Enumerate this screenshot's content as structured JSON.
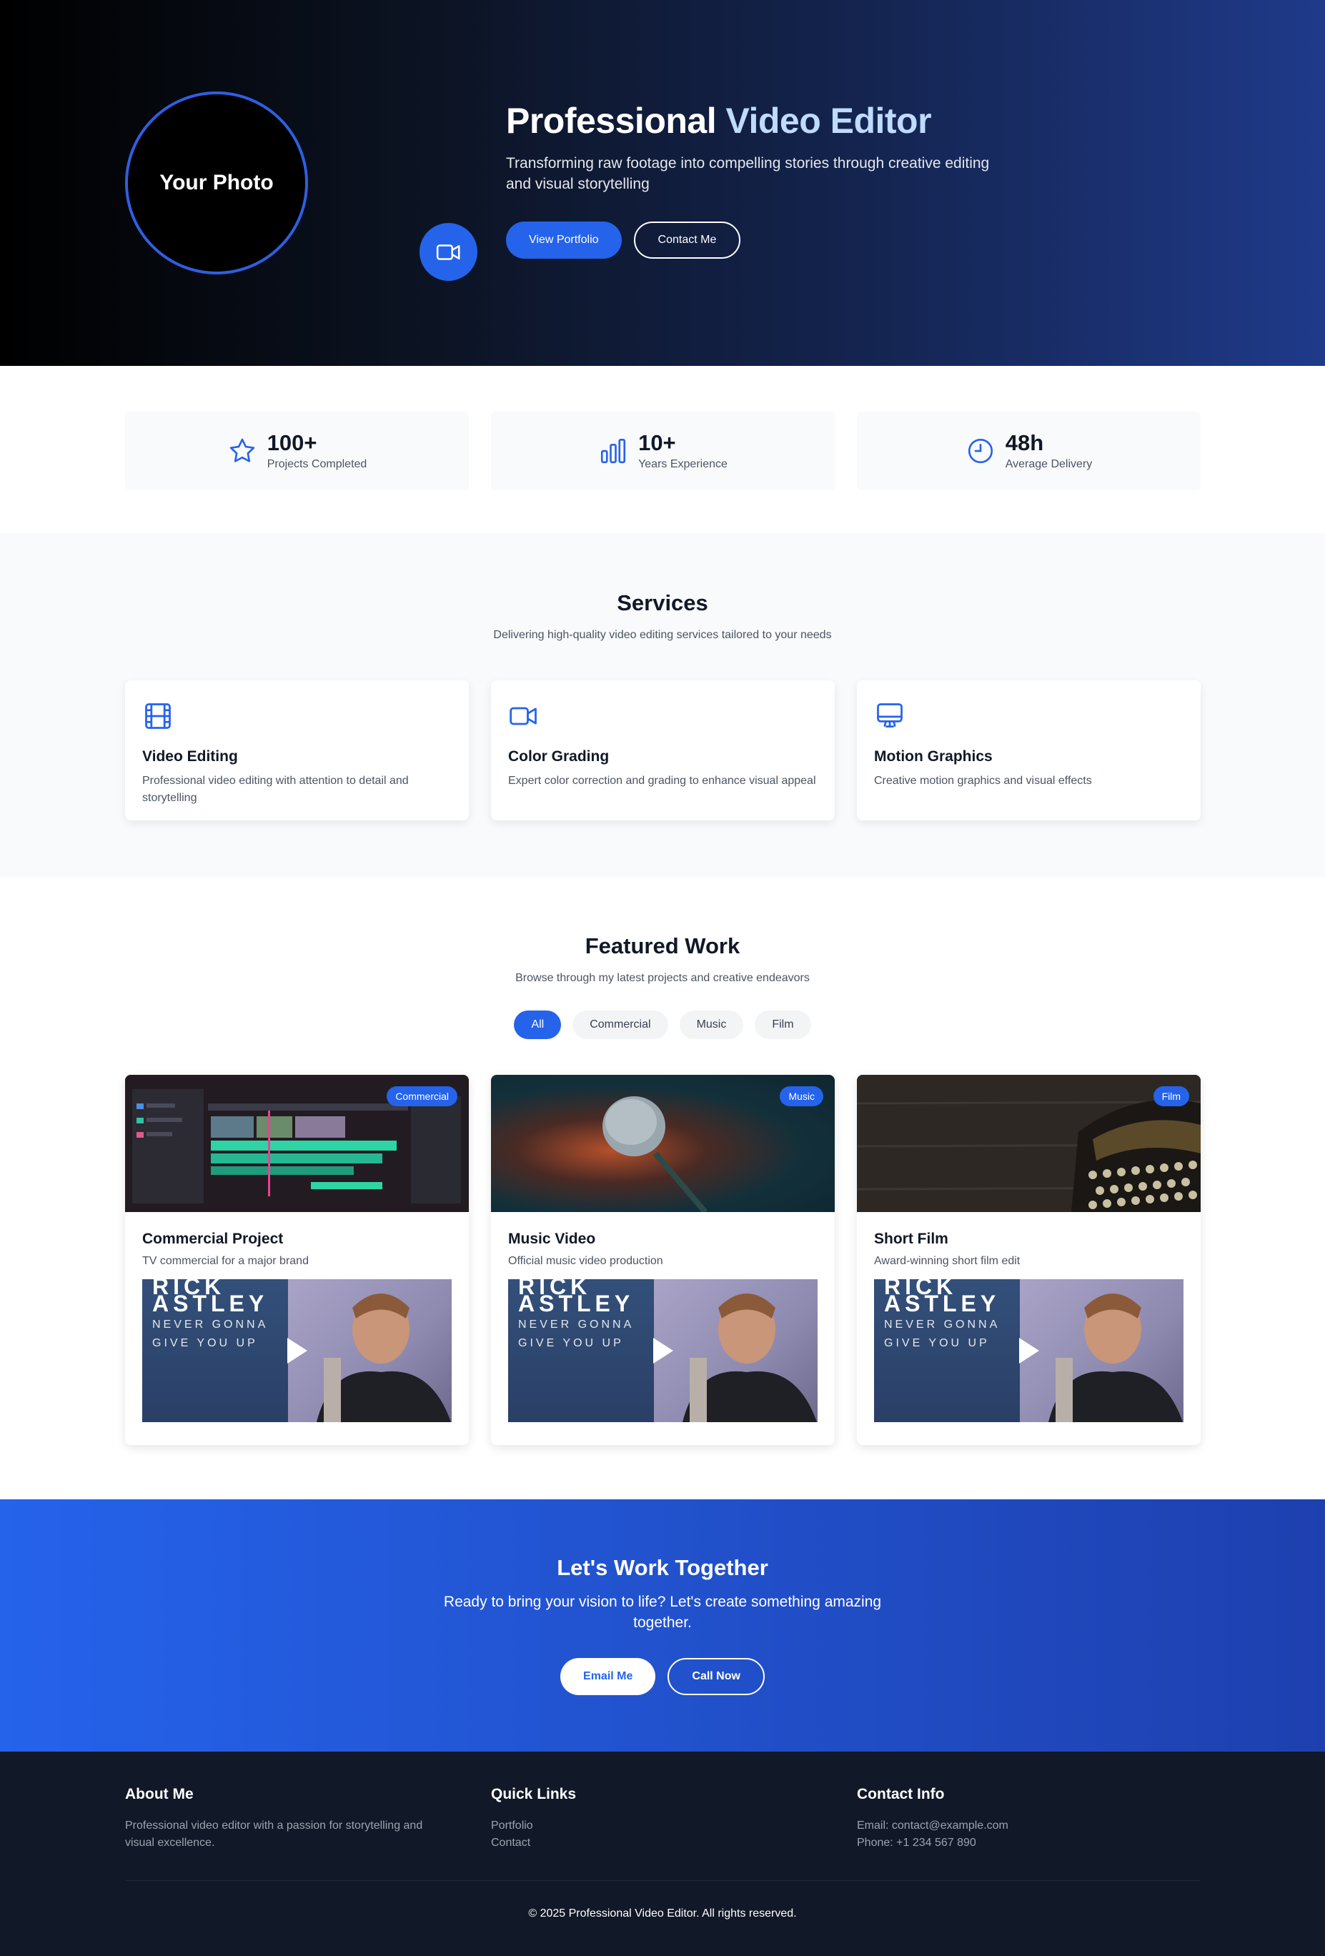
{
  "hero": {
    "photo_label": "Your Photo",
    "title_part1": "Professional ",
    "title_part2": "Video Editor",
    "subtitle": "Transforming raw footage into compelling stories through creative editing and visual storytelling",
    "btn_portfolio": "View Portfolio",
    "btn_contact": "Contact Me"
  },
  "stats": [
    {
      "icon": "star-icon",
      "value": "100+",
      "label": "Projects Completed"
    },
    {
      "icon": "bar-chart-icon",
      "value": "10+",
      "label": "Years Experience"
    },
    {
      "icon": "clock-icon",
      "value": "48h",
      "label": "Average Delivery"
    }
  ],
  "services": {
    "title": "Services",
    "subtitle": "Delivering high-quality video editing services tailored to your needs",
    "items": [
      {
        "icon": "film-icon",
        "title": "Video Editing",
        "desc": "Professional video editing with attention to detail and storytelling"
      },
      {
        "icon": "video-camera-icon",
        "title": "Color Grading",
        "desc": "Expert color correction and grading to enhance visual appeal"
      },
      {
        "icon": "monitor-icon",
        "title": "Motion Graphics",
        "desc": "Creative motion graphics and visual effects"
      }
    ]
  },
  "work": {
    "title": "Featured Work",
    "subtitle": "Browse through my latest projects and creative endeavors",
    "filters": [
      "All",
      "Commercial",
      "Music",
      "Film"
    ],
    "active_filter": "All",
    "video_text": {
      "line1": "RICK",
      "line2": "ASTLEY",
      "line3": "NEVER GONNA",
      "line4": "GIVE YOU UP"
    },
    "projects": [
      {
        "badge": "Commercial",
        "title": "Commercial Project",
        "desc": "TV commercial for a major brand"
      },
      {
        "badge": "Music",
        "title": "Music Video",
        "desc": "Official music video production"
      },
      {
        "badge": "Film",
        "title": "Short Film",
        "desc": "Award-winning short film edit"
      }
    ]
  },
  "cta": {
    "title": "Let's Work Together",
    "subtitle": "Ready to bring your vision to life? Let's create something amazing together.",
    "btn_email": "Email Me",
    "btn_call": "Call Now"
  },
  "footer": {
    "about_title": "About Me",
    "about_text": "Professional video editor with a passion for storytelling and visual excellence.",
    "links_title": "Quick Links",
    "links": [
      "Portfolio",
      "Contact"
    ],
    "contact_title": "Contact Info",
    "email": "Email: contact@example.com",
    "phone": "Phone: +1 234 567 890",
    "copyright": "© 2025 Professional Video Editor. All rights reserved."
  },
  "colors": {
    "accent": "#2563eb",
    "dark": "#111827",
    "title_accent": "#bfdbfe"
  }
}
